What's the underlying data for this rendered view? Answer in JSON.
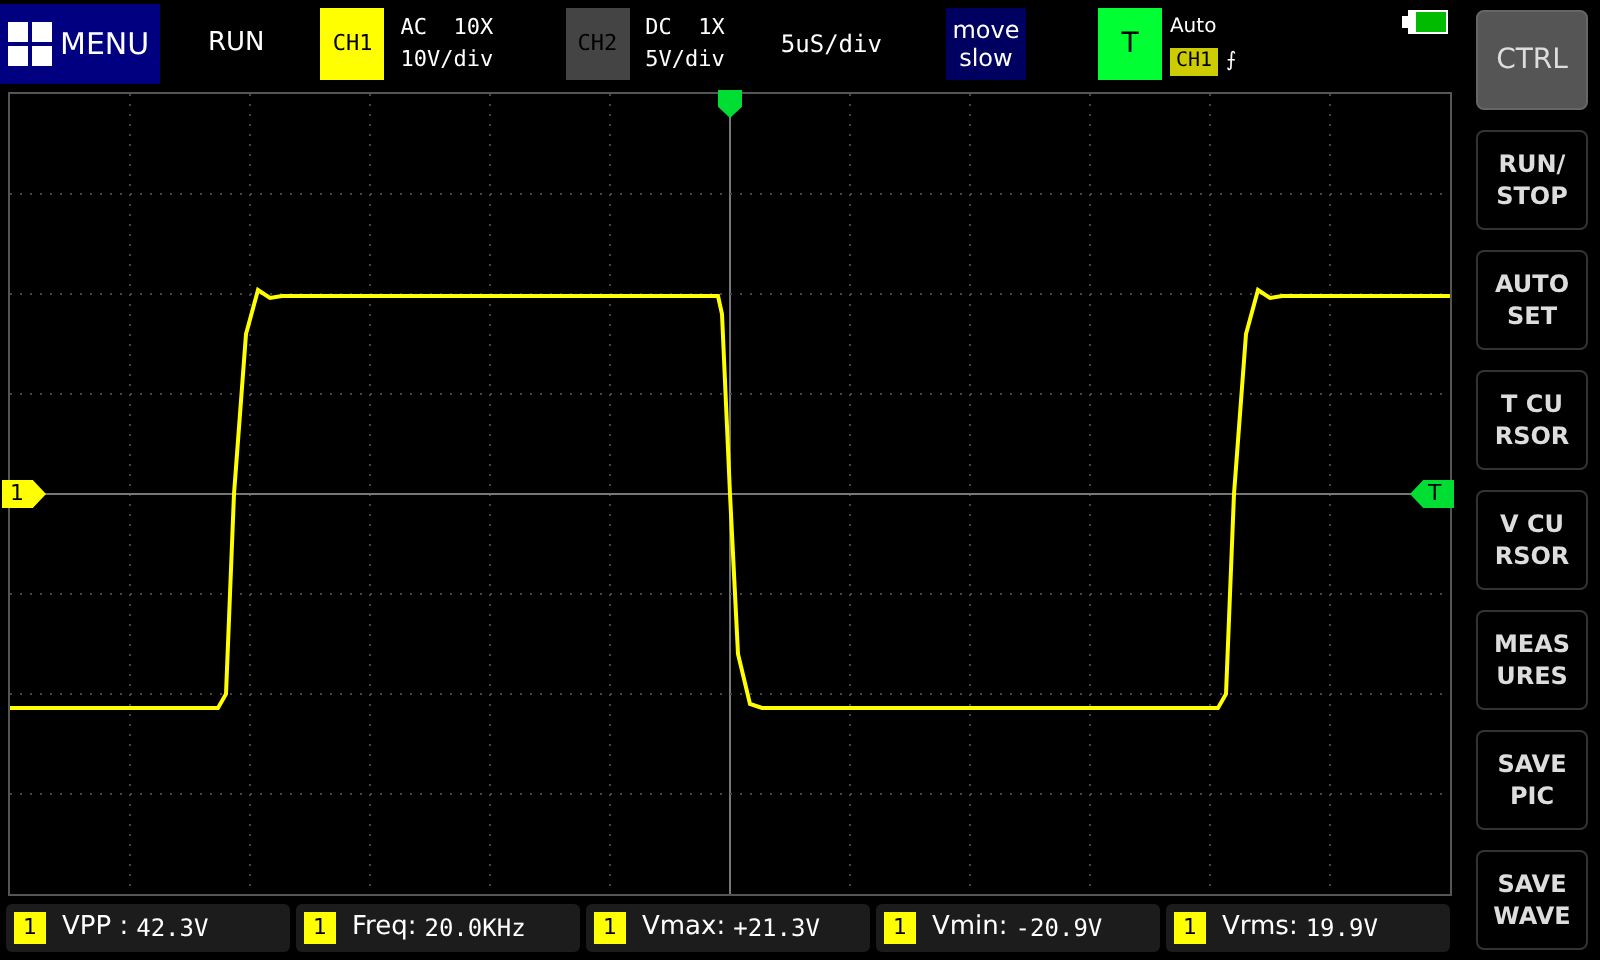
{
  "menu_button": {
    "label": "MENU"
  },
  "run_state": "RUN",
  "channels": [
    {
      "badge": "CH1",
      "selected": true,
      "coupling": "AC  10X",
      "scale": "10V/div"
    },
    {
      "badge": "CH2",
      "selected": false,
      "coupling": "DC  1X",
      "scale": "5V/div"
    }
  ],
  "timebase": "5uS/div",
  "move_mode": {
    "lines": [
      "move",
      "slow"
    ]
  },
  "trigger": {
    "badge": "T",
    "mode": "Auto",
    "source": "CH1",
    "edge": "⨍"
  },
  "battery": {
    "level": 0.85
  },
  "plot": {
    "channel_marker": "1",
    "trigger_marker": "T"
  },
  "sidebar": [
    {
      "lines": [
        "CTRL"
      ],
      "selected": true
    },
    {
      "lines": [
        "RUN/",
        "STOP"
      ],
      "selected": false
    },
    {
      "lines": [
        "AUTO",
        "SET"
      ],
      "selected": false
    },
    {
      "lines": [
        "T CU",
        "RSOR"
      ],
      "selected": false
    },
    {
      "lines": [
        "V CU",
        "RSOR"
      ],
      "selected": false
    },
    {
      "lines": [
        "MEAS",
        "URES"
      ],
      "selected": false
    },
    {
      "lines": [
        "SAVE",
        "PIC"
      ],
      "selected": false
    },
    {
      "lines": [
        "SAVE",
        "WAVE"
      ],
      "selected": false
    }
  ],
  "measurements": [
    {
      "channel": "1",
      "label": "VPP :",
      "value": "42.3V"
    },
    {
      "channel": "1",
      "label": "Freq:",
      "value": "20.0KHz"
    },
    {
      "channel": "1",
      "label": "Vmax:",
      "value": "+21.3V"
    },
    {
      "channel": "1",
      "label": "Vmin:",
      "value": "-20.9V"
    },
    {
      "channel": "1",
      "label": "Vrms:",
      "value": "19.9V"
    }
  ]
}
